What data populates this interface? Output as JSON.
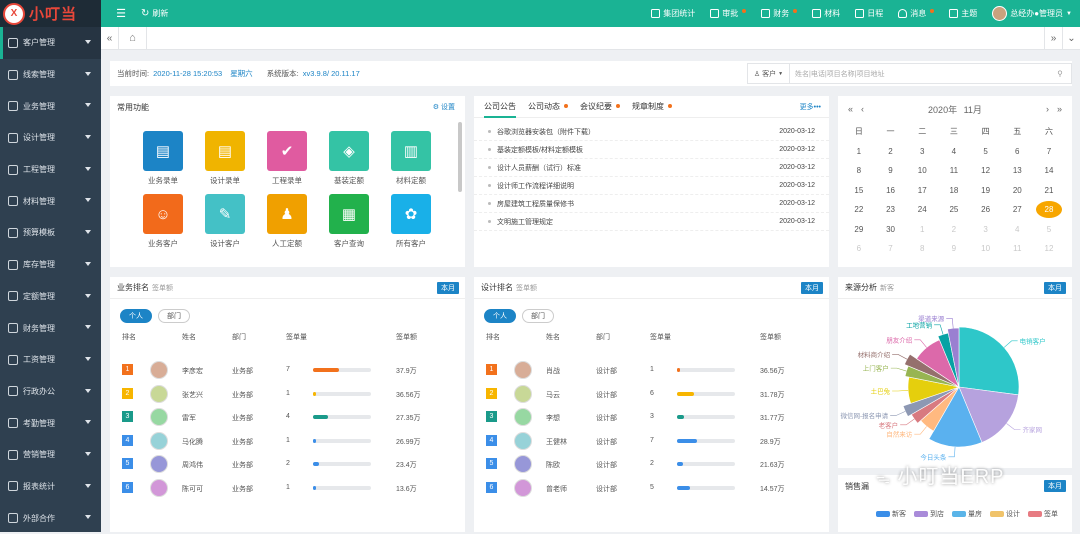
{
  "app": {
    "logo_mark": "X",
    "logo_text": "小叮当"
  },
  "sidebar": {
    "items": [
      {
        "label": "客户管理"
      },
      {
        "label": "线索管理"
      },
      {
        "label": "业务管理"
      },
      {
        "label": "设计管理"
      },
      {
        "label": "工程管理"
      },
      {
        "label": "材料管理"
      },
      {
        "label": "预算模板"
      },
      {
        "label": "库存管理"
      },
      {
        "label": "定额管理"
      },
      {
        "label": "财务管理"
      },
      {
        "label": "工资管理"
      },
      {
        "label": "行政办公"
      },
      {
        "label": "考勤管理"
      },
      {
        "label": "营销管理"
      },
      {
        "label": "报表统计"
      },
      {
        "label": "外部合作"
      }
    ]
  },
  "topbar": {
    "menu_icon": "☰",
    "refresh": "刷新",
    "items": [
      "集团统计",
      "审批",
      "财务",
      "材料",
      "日程",
      "消息",
      "主题"
    ],
    "user": "总经办●管理员"
  },
  "tabs": {
    "home_icon": "⌂"
  },
  "info": {
    "time_label": "当前时间:",
    "time_value": "2020-11-28 15:20:53",
    "weekday": "星期六",
    "version_label": "系统版本:",
    "version_value": "xv3.9.8/ 20.11.17",
    "search_scope": "客户",
    "search_placeholder": "姓名|电话|项目名称|项目地址"
  },
  "quick": {
    "title": "常用功能",
    "settings": "设置",
    "items": [
      {
        "label": "业务录单",
        "color": "#1c84c6",
        "icon": "▤"
      },
      {
        "label": "设计录单",
        "color": "#f0b400",
        "icon": "▤"
      },
      {
        "label": "工程录单",
        "color": "#e05ba0",
        "icon": "✔"
      },
      {
        "label": "基装定额",
        "color": "#34c3a5",
        "icon": "◈"
      },
      {
        "label": "材料定额",
        "color": "#34c3a5",
        "icon": "▥"
      },
      {
        "label": "业务客户",
        "color": "#f26a1b",
        "icon": "☺"
      },
      {
        "label": "设计客户",
        "color": "#44c1c6",
        "icon": "✎"
      },
      {
        "label": "人工定额",
        "color": "#f0a000",
        "icon": "♟"
      },
      {
        "label": "客户查询",
        "color": "#22b14c",
        "icon": "▦"
      },
      {
        "label": "所有客户",
        "color": "#19b0e8",
        "icon": "✿"
      }
    ]
  },
  "notice": {
    "tabs": [
      "公司公告",
      "公司动态",
      "会议纪要",
      "规章制度"
    ],
    "more": "更多•••",
    "rows": [
      {
        "title": "谷歌浏览器安装包（附件下载）",
        "date": "2020-03-12"
      },
      {
        "title": "基装定额模板/材料定额模板",
        "date": "2020-03-12"
      },
      {
        "title": "设计人员薪酬（试行）标准",
        "date": "2020-03-12"
      },
      {
        "title": "设计师工作流程详细说明",
        "date": "2020-03-12"
      },
      {
        "title": "房屋建筑工程质量保修书",
        "date": "2020-03-12"
      },
      {
        "title": "文明施工管理规定",
        "date": "2020-03-12"
      }
    ]
  },
  "calendar": {
    "year": "2020年",
    "month": "11月",
    "weekdays": [
      "日",
      "一",
      "二",
      "三",
      "四",
      "五",
      "六"
    ],
    "days": [
      {
        "d": "1"
      },
      {
        "d": "2"
      },
      {
        "d": "3"
      },
      {
        "d": "4"
      },
      {
        "d": "5"
      },
      {
        "d": "6"
      },
      {
        "d": "7"
      },
      {
        "d": "8"
      },
      {
        "d": "9"
      },
      {
        "d": "10"
      },
      {
        "d": "11"
      },
      {
        "d": "12"
      },
      {
        "d": "13"
      },
      {
        "d": "14"
      },
      {
        "d": "15"
      },
      {
        "d": "16"
      },
      {
        "d": "17"
      },
      {
        "d": "18"
      },
      {
        "d": "19"
      },
      {
        "d": "20"
      },
      {
        "d": "21"
      },
      {
        "d": "22"
      },
      {
        "d": "23"
      },
      {
        "d": "24"
      },
      {
        "d": "25"
      },
      {
        "d": "26"
      },
      {
        "d": "27"
      },
      {
        "d": "28",
        "today": true
      },
      {
        "d": "29"
      },
      {
        "d": "30"
      },
      {
        "d": "1",
        "off": true
      },
      {
        "d": "2",
        "off": true
      },
      {
        "d": "3",
        "off": true
      },
      {
        "d": "4",
        "off": true
      },
      {
        "d": "5",
        "off": true
      },
      {
        "d": "6",
        "off": true
      },
      {
        "d": "7",
        "off": true
      },
      {
        "d": "8",
        "off": true
      },
      {
        "d": "9",
        "off": true
      },
      {
        "d": "10",
        "off": true
      },
      {
        "d": "11",
        "off": true
      },
      {
        "d": "12",
        "off": true
      }
    ]
  },
  "sales_rank": {
    "title": "业务排名",
    "subtitle": "签单额",
    "badge": "本月",
    "pills": [
      "个人",
      "部门"
    ],
    "headers": [
      "排名",
      "姓名",
      "部门",
      "签单量",
      "签单额"
    ],
    "rows": [
      {
        "rank": "1",
        "name": "李彦宏",
        "dept": "业务部",
        "count": "7",
        "amount": "37.9万",
        "fill": 0.45,
        "bar": "#f2711c",
        "rank_color": "#f2711c"
      },
      {
        "rank": "2",
        "name": "张艺兴",
        "dept": "业务部",
        "count": "1",
        "amount": "36.56万",
        "fill": 0.05,
        "bar": "#f7b500",
        "rank_color": "#f7b500"
      },
      {
        "rank": "3",
        "name": "雷军",
        "dept": "业务部",
        "count": "4",
        "amount": "27.35万",
        "fill": 0.26,
        "bar": "#1a9a8a",
        "rank_color": "#1a9a8a"
      },
      {
        "rank": "4",
        "name": "马化腾",
        "dept": "业务部",
        "count": "1",
        "amount": "26.99万",
        "fill": 0.05,
        "bar": "#3b8ee8",
        "rank_color": "#3b8ee8"
      },
      {
        "rank": "5",
        "name": "周鸿伟",
        "dept": "业务部",
        "count": "2",
        "amount": "23.4万",
        "fill": 0.1,
        "bar": "#3b8ee8",
        "rank_color": "#3b8ee8"
      },
      {
        "rank": "6",
        "name": "陈可可",
        "dept": "业务部",
        "count": "1",
        "amount": "13.6万",
        "fill": 0.05,
        "bar": "#3b8ee8",
        "rank_color": "#3b8ee8"
      }
    ]
  },
  "design_rank": {
    "title": "设计排名",
    "subtitle": "签单额",
    "badge": "本月",
    "pills": [
      "个人",
      "部门"
    ],
    "headers": [
      "排名",
      "姓名",
      "部门",
      "签单量",
      "签单额"
    ],
    "rows": [
      {
        "rank": "1",
        "name": "肖战",
        "dept": "设计部",
        "count": "1",
        "amount": "36.56万",
        "fill": 0.05,
        "bar": "#f2711c",
        "rank_color": "#f2711c"
      },
      {
        "rank": "2",
        "name": "马云",
        "dept": "设计部",
        "count": "6",
        "amount": "31.78万",
        "fill": 0.3,
        "bar": "#f7b500",
        "rank_color": "#f7b500"
      },
      {
        "rank": "3",
        "name": "李想",
        "dept": "设计部",
        "count": "3",
        "amount": "31.77万",
        "fill": 0.12,
        "bar": "#1a9a8a",
        "rank_color": "#1a9a8a"
      },
      {
        "rank": "4",
        "name": "王健林",
        "dept": "设计部",
        "count": "7",
        "amount": "28.9万",
        "fill": 0.34,
        "bar": "#3b8ee8",
        "rank_color": "#3b8ee8"
      },
      {
        "rank": "5",
        "name": "陈欧",
        "dept": "设计部",
        "count": "2",
        "amount": "21.63万",
        "fill": 0.1,
        "bar": "#3b8ee8",
        "rank_color": "#3b8ee8"
      },
      {
        "rank": "6",
        "name": "曾老师",
        "dept": "设计部",
        "count": "5",
        "amount": "14.57万",
        "fill": 0.22,
        "bar": "#3b8ee8",
        "rank_color": "#3b8ee8"
      }
    ]
  },
  "source": {
    "title": "来源分析",
    "subtitle": "新客",
    "badge": "本月",
    "bottom_title": "销售漏",
    "bottom_badge": "本月",
    "watermark": "小叮当ERP",
    "legend": [
      {
        "label": "新客",
        "color": "#3b8ee8"
      },
      {
        "label": "到店",
        "color": "#a98bd9"
      },
      {
        "label": "量房",
        "color": "#5ab4e8"
      },
      {
        "label": "设计",
        "color": "#f0c36a"
      },
      {
        "label": "签单",
        "color": "#e77b82"
      }
    ]
  },
  "chart_data": {
    "type": "pie",
    "title": "来源分析",
    "slices": [
      {
        "label": "电销客户",
        "value": 26,
        "color": "#2ec7c9"
      },
      {
        "label": "齐家网",
        "value": 16,
        "color": "#b6a2de"
      },
      {
        "label": "今日头条",
        "value": 14,
        "color": "#5ab1ef"
      },
      {
        "label": "自然来访",
        "value": 5,
        "color": "#ffb980"
      },
      {
        "label": "老客户",
        "value": 3,
        "color": "#d87a80"
      },
      {
        "label": "微信网-报名申请",
        "value": 3,
        "color": "#8d98b3"
      },
      {
        "label": "土巴兔",
        "value": 8,
        "color": "#e5cf0d"
      },
      {
        "label": "上门客户",
        "value": 3,
        "color": "#97b552"
      },
      {
        "label": "材料商介绍",
        "value": 3,
        "color": "#95706d"
      },
      {
        "label": "朋友介绍",
        "value": 9,
        "color": "#dc69aa"
      },
      {
        "label": "工地营销",
        "value": 3,
        "color": "#07a2a4"
      },
      {
        "label": "渠道来源",
        "value": 3,
        "color": "#9a7fd1"
      }
    ]
  }
}
